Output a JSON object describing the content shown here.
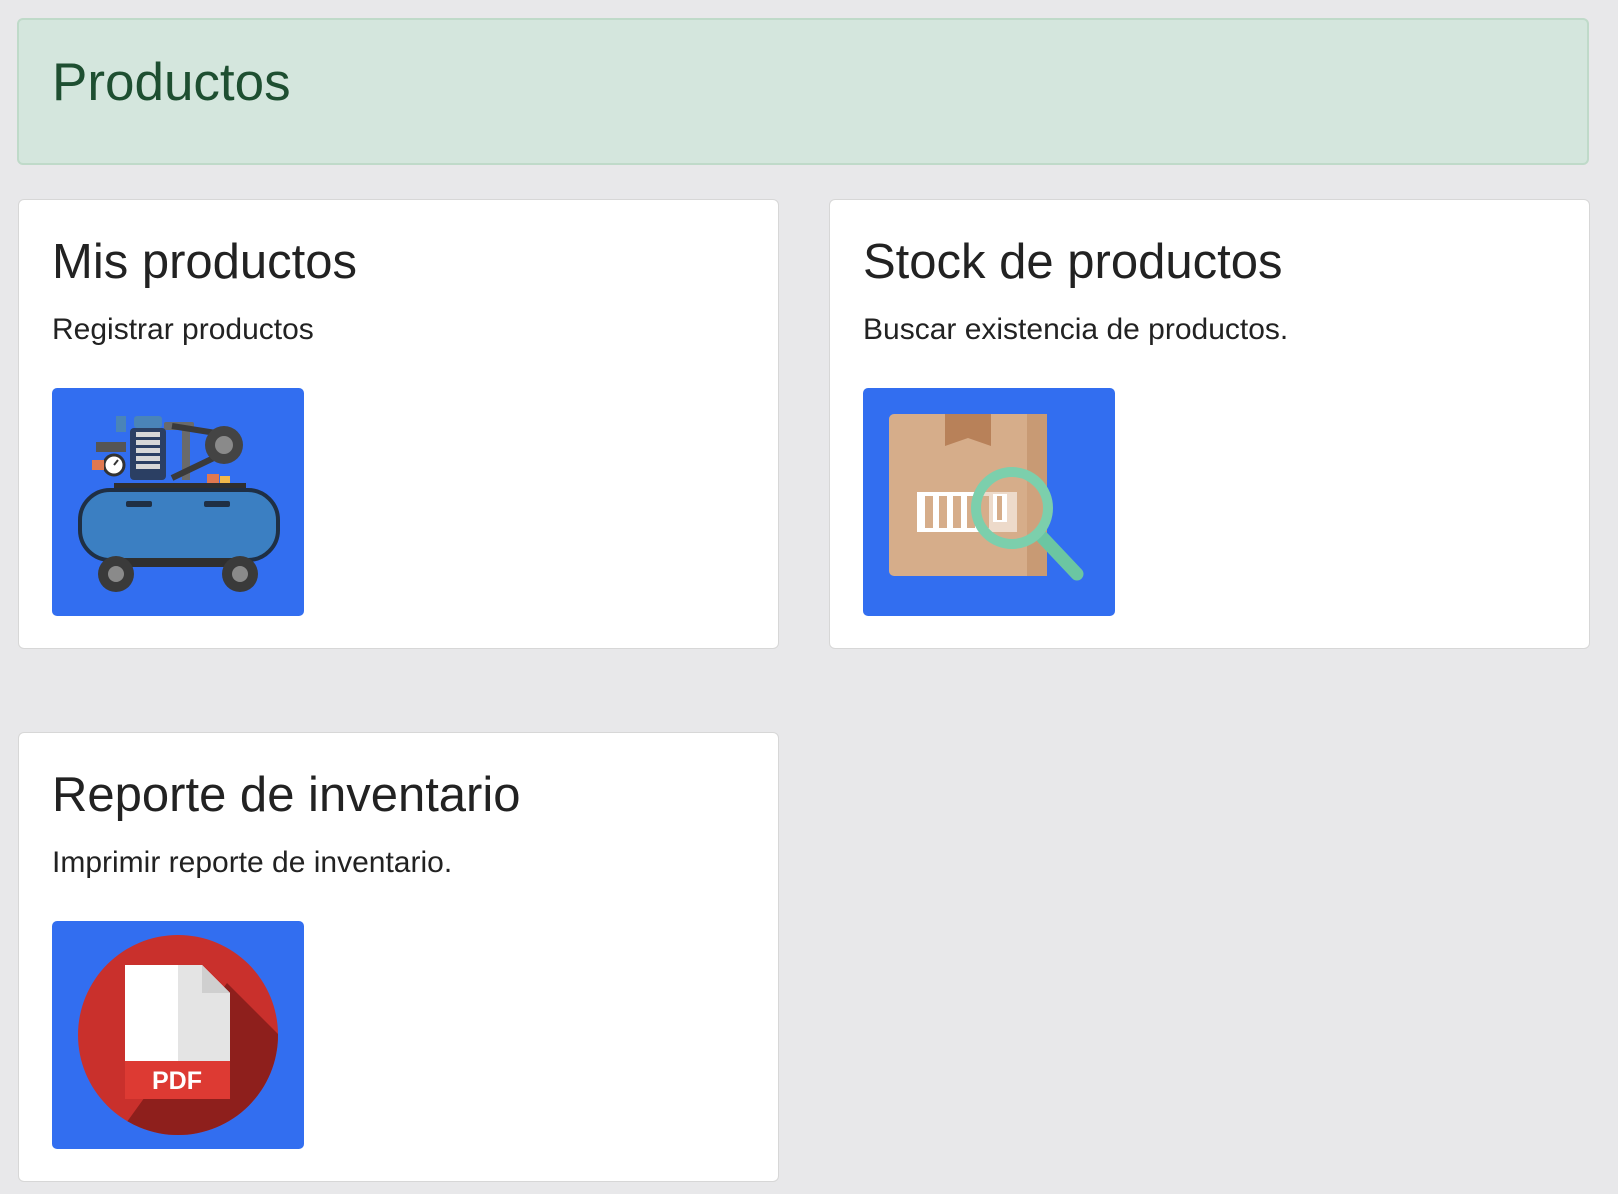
{
  "header": {
    "title": "Productos",
    "background_color": "#d4e6dd",
    "title_color": "#1e4f31"
  },
  "cards": [
    {
      "title": "Mis productos",
      "description": "Registrar productos",
      "icon": "air-compressor-icon"
    },
    {
      "title": "Stock de productos",
      "description": "Buscar existencia de productos.",
      "icon": "box-search-icon"
    },
    {
      "title": "Reporte de inventario",
      "description": "Imprimir reporte de inventario.",
      "icon": "pdf-file-icon",
      "icon_label": "PDF"
    }
  ],
  "colors": {
    "page_background": "#e8e8ea",
    "card_image_background": "#326ef0"
  }
}
